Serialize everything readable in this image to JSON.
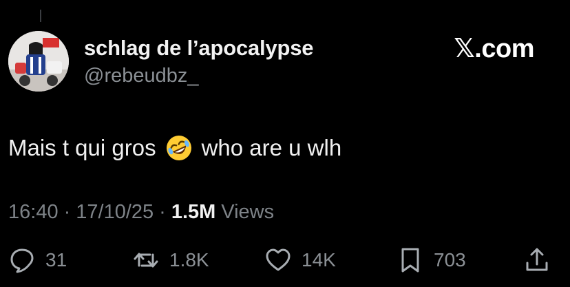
{
  "author": {
    "display_name": "schlag de l’apocalypse",
    "handle": "@rebeudbz_"
  },
  "brand": "𝕏.com",
  "tweet": {
    "text_before": "Mais t qui gros",
    "emoji": "rolling-on-the-floor-laughing-emoji",
    "text_after": "who are u wlh"
  },
  "meta": {
    "time": "16:40",
    "sep1": "·",
    "date": "17/10/25",
    "sep2": "·",
    "views_count": "1.5M",
    "views_label": "Views"
  },
  "actions": {
    "replies": "31",
    "reposts": "1.8K",
    "likes": "14K",
    "bookmarks": "703"
  },
  "colors": {
    "background": "#000000",
    "text": "#f0f0f0",
    "muted": "#8b9095"
  }
}
